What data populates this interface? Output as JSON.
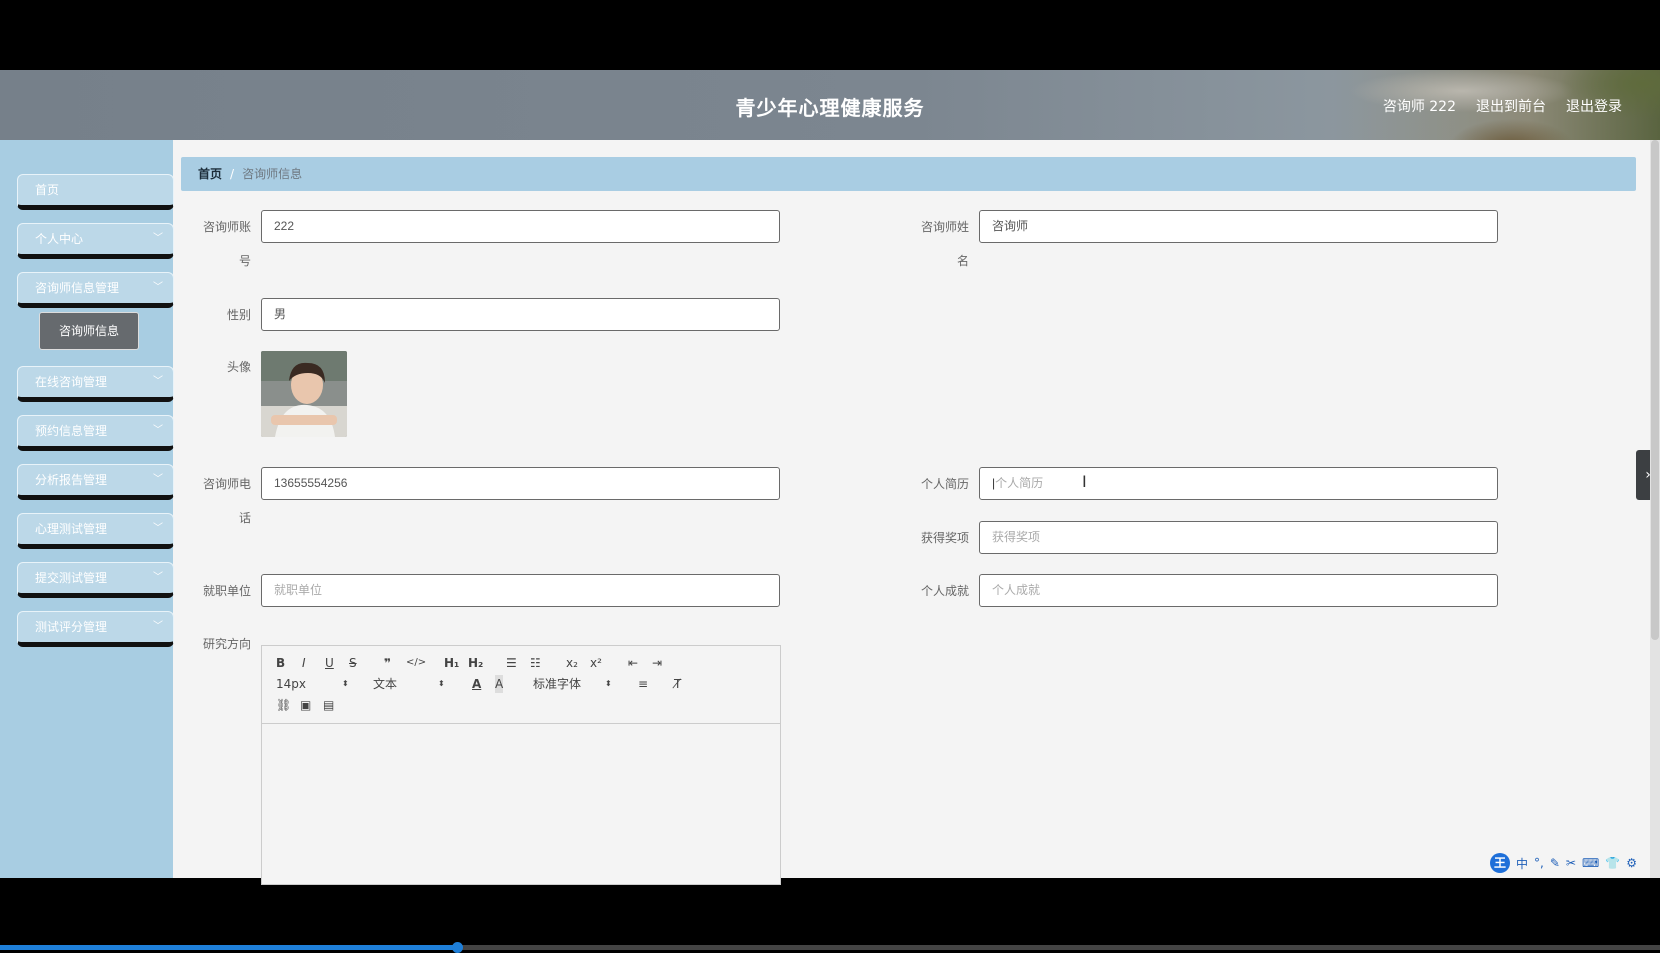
{
  "header": {
    "title": "青少年心理健康服务",
    "user_label": "咨询师 222",
    "back_to_front": "退出到前台",
    "logout": "退出登录"
  },
  "sidebar": {
    "items": [
      {
        "label": "首页"
      },
      {
        "label": "个人中心"
      },
      {
        "label": "咨询师信息管理"
      },
      {
        "label": "在线咨询管理"
      },
      {
        "label": "预约信息管理"
      },
      {
        "label": "分析报告管理"
      },
      {
        "label": "心理测试管理"
      },
      {
        "label": "提交测试管理"
      },
      {
        "label": "测试评分管理"
      }
    ],
    "submenu_item": "咨询师信息"
  },
  "breadcrumb": {
    "home": "首页",
    "current": "咨询师信息"
  },
  "form": {
    "account_label_1": "咨询师账",
    "account_label_2": "号",
    "account_value": "222",
    "name_label_1": "咨询师姓",
    "name_label_2": "名",
    "name_value": "咨询师",
    "gender_label": "性别",
    "gender_value": "男",
    "avatar_label": "头像",
    "phone_label_1": "咨询师电",
    "phone_label_2": "话",
    "phone_value": "13655554256",
    "resume_label": "个人简历",
    "resume_placeholder": "个人简历",
    "awards_label": "获得奖项",
    "awards_placeholder": "获得奖项",
    "employer_label": "就职单位",
    "employer_placeholder": "就职单位",
    "achievement_label": "个人成就",
    "achievement_placeholder": "个人成就",
    "research_label": "研究方向"
  },
  "editor": {
    "bold": "B",
    "italic": "I",
    "underline": "U",
    "strike": "S",
    "quote": "❞",
    "code": "</>",
    "h1": "H₁",
    "h2": "H₂",
    "ol": "☰",
    "ul": "☷",
    "sub": "x₂",
    "sup": "x²",
    "indent_out": "⇤",
    "indent_in": "⇥",
    "font_size": "14px",
    "header_select": "文本",
    "font_color": "A",
    "bg_color": "A",
    "font_family": "标准字体",
    "align": "≡",
    "clean": "T̸",
    "link": "⛓",
    "image": "▣",
    "video": "▤"
  },
  "ime": {
    "logo": "王",
    "lang": "中"
  },
  "video_progress": 0.275
}
